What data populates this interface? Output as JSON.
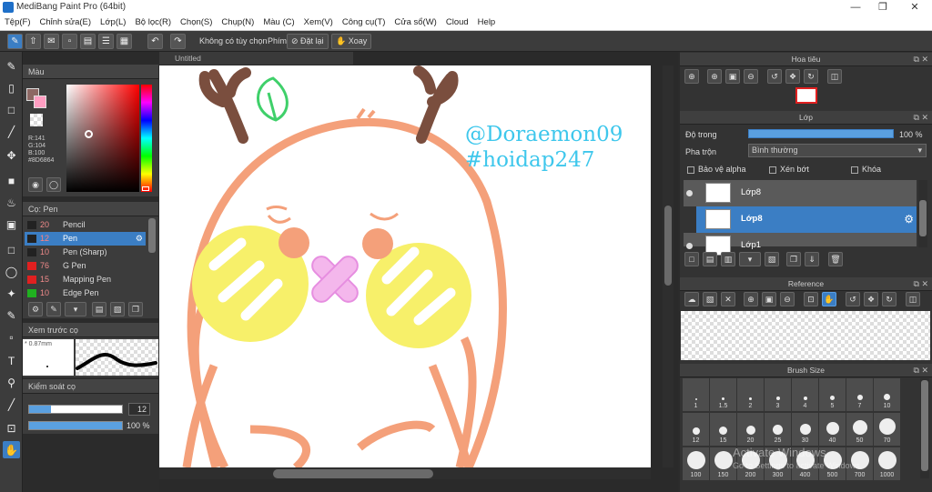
{
  "window": {
    "title": "MediBang Paint Pro (64bit)"
  },
  "menu": [
    "Tệp(F)",
    "Chỉnh sửa(E)",
    "Lớp(L)",
    "Bộ lọc(R)",
    "Chọn(S)",
    "Chụp(N)",
    "Màu (C)",
    "Xem(V)",
    "Công cụ(T)",
    "Cửa sổ(W)",
    "Cloud",
    "Help"
  ],
  "toolbar": {
    "no_option": "Không có tùy chọn",
    "key_label": "Phím",
    "reset_label": "Đặt lại",
    "rotate_label": "Xoay"
  },
  "document": {
    "tab_title": "Untitled"
  },
  "canvas": {
    "text1": "@Doraemon09",
    "text2": "#hoidap247"
  },
  "color_panel": {
    "title": "Màu",
    "r": "R:141",
    "g": "G:104",
    "b": "B:100",
    "hex": "#8D6864",
    "fg_color": "#8D6864",
    "bg_color": "#ff9ec2"
  },
  "brush_panel": {
    "title": "Cọ: Pen",
    "items": [
      {
        "size": "20",
        "name": "Pencil",
        "color": "#222222"
      },
      {
        "size": "12",
        "name": "Pen",
        "color": "#222222",
        "selected": true
      },
      {
        "size": "10",
        "name": "Pen (Sharp)",
        "color": "#222222"
      },
      {
        "size": "76",
        "name": "G Pen",
        "color": "#e02020"
      },
      {
        "size": "15",
        "name": "Mapping Pen",
        "color": "#e02020"
      },
      {
        "size": "10",
        "name": "Edge Pen",
        "color": "#20b020"
      }
    ]
  },
  "preview_panel": {
    "title": "Xem trước cọ",
    "size": "0.87mm"
  },
  "control_panel": {
    "title": "Kiểm soát cọ",
    "size_value": "12",
    "opacity_value": "100 %"
  },
  "navigator": {
    "title": "Hoa tiêu"
  },
  "layer_panel": {
    "title": "Lớp",
    "opacity_label": "Độ trong",
    "opacity_value": "100 %",
    "blend_label": "Pha trộn",
    "blend_value": "Bình thường",
    "protect_alpha": "Bảo vệ alpha",
    "clipping": "Xén bớt",
    "lock": "Khóa",
    "layers": [
      {
        "name": "Lớp8",
        "selected": false
      },
      {
        "name": "Lớp8",
        "selected": true
      },
      {
        "name": "Lớp1",
        "selected": false
      }
    ]
  },
  "reference_panel": {
    "title": "Reference"
  },
  "brush_size_panel": {
    "title": "Brush Size",
    "sizes": [
      "1",
      "1.5",
      "2",
      "3",
      "4",
      "5",
      "7",
      "10",
      "12",
      "15",
      "20",
      "25",
      "30",
      "40",
      "50",
      "70",
      "100",
      "150",
      "200",
      "300",
      "400",
      "500",
      "700",
      "1000"
    ]
  },
  "os_watermark": {
    "line1": "Activate Windows",
    "line2": "Go to Settings to activate Windows."
  }
}
